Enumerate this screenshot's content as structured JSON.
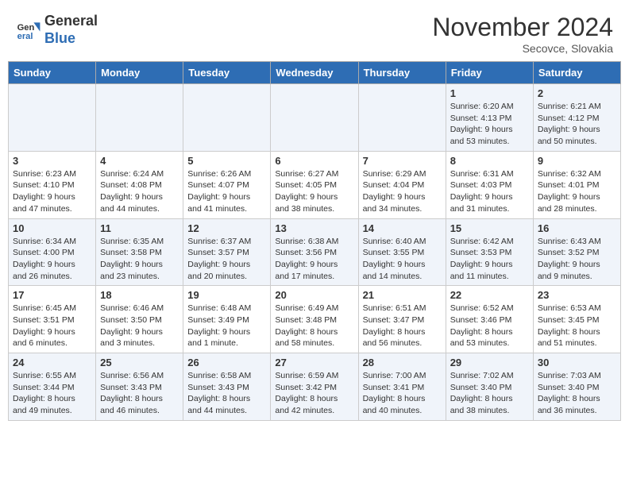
{
  "logo": {
    "line1": "General",
    "line2": "Blue"
  },
  "title": "November 2024",
  "subtitle": "Secovce, Slovakia",
  "days_of_week": [
    "Sunday",
    "Monday",
    "Tuesday",
    "Wednesday",
    "Thursday",
    "Friday",
    "Saturday"
  ],
  "weeks": [
    [
      {
        "day": "",
        "info": ""
      },
      {
        "day": "",
        "info": ""
      },
      {
        "day": "",
        "info": ""
      },
      {
        "day": "",
        "info": ""
      },
      {
        "day": "",
        "info": ""
      },
      {
        "day": "1",
        "info": "Sunrise: 6:20 AM\nSunset: 4:13 PM\nDaylight: 9 hours and 53 minutes."
      },
      {
        "day": "2",
        "info": "Sunrise: 6:21 AM\nSunset: 4:12 PM\nDaylight: 9 hours and 50 minutes."
      }
    ],
    [
      {
        "day": "3",
        "info": "Sunrise: 6:23 AM\nSunset: 4:10 PM\nDaylight: 9 hours and 47 minutes."
      },
      {
        "day": "4",
        "info": "Sunrise: 6:24 AM\nSunset: 4:08 PM\nDaylight: 9 hours and 44 minutes."
      },
      {
        "day": "5",
        "info": "Sunrise: 6:26 AM\nSunset: 4:07 PM\nDaylight: 9 hours and 41 minutes."
      },
      {
        "day": "6",
        "info": "Sunrise: 6:27 AM\nSunset: 4:05 PM\nDaylight: 9 hours and 38 minutes."
      },
      {
        "day": "7",
        "info": "Sunrise: 6:29 AM\nSunset: 4:04 PM\nDaylight: 9 hours and 34 minutes."
      },
      {
        "day": "8",
        "info": "Sunrise: 6:31 AM\nSunset: 4:03 PM\nDaylight: 9 hours and 31 minutes."
      },
      {
        "day": "9",
        "info": "Sunrise: 6:32 AM\nSunset: 4:01 PM\nDaylight: 9 hours and 28 minutes."
      }
    ],
    [
      {
        "day": "10",
        "info": "Sunrise: 6:34 AM\nSunset: 4:00 PM\nDaylight: 9 hours and 26 minutes."
      },
      {
        "day": "11",
        "info": "Sunrise: 6:35 AM\nSunset: 3:58 PM\nDaylight: 9 hours and 23 minutes."
      },
      {
        "day": "12",
        "info": "Sunrise: 6:37 AM\nSunset: 3:57 PM\nDaylight: 9 hours and 20 minutes."
      },
      {
        "day": "13",
        "info": "Sunrise: 6:38 AM\nSunset: 3:56 PM\nDaylight: 9 hours and 17 minutes."
      },
      {
        "day": "14",
        "info": "Sunrise: 6:40 AM\nSunset: 3:55 PM\nDaylight: 9 hours and 14 minutes."
      },
      {
        "day": "15",
        "info": "Sunrise: 6:42 AM\nSunset: 3:53 PM\nDaylight: 9 hours and 11 minutes."
      },
      {
        "day": "16",
        "info": "Sunrise: 6:43 AM\nSunset: 3:52 PM\nDaylight: 9 hours and 9 minutes."
      }
    ],
    [
      {
        "day": "17",
        "info": "Sunrise: 6:45 AM\nSunset: 3:51 PM\nDaylight: 9 hours and 6 minutes."
      },
      {
        "day": "18",
        "info": "Sunrise: 6:46 AM\nSunset: 3:50 PM\nDaylight: 9 hours and 3 minutes."
      },
      {
        "day": "19",
        "info": "Sunrise: 6:48 AM\nSunset: 3:49 PM\nDaylight: 9 hours and 1 minute."
      },
      {
        "day": "20",
        "info": "Sunrise: 6:49 AM\nSunset: 3:48 PM\nDaylight: 8 hours and 58 minutes."
      },
      {
        "day": "21",
        "info": "Sunrise: 6:51 AM\nSunset: 3:47 PM\nDaylight: 8 hours and 56 minutes."
      },
      {
        "day": "22",
        "info": "Sunrise: 6:52 AM\nSunset: 3:46 PM\nDaylight: 8 hours and 53 minutes."
      },
      {
        "day": "23",
        "info": "Sunrise: 6:53 AM\nSunset: 3:45 PM\nDaylight: 8 hours and 51 minutes."
      }
    ],
    [
      {
        "day": "24",
        "info": "Sunrise: 6:55 AM\nSunset: 3:44 PM\nDaylight: 8 hours and 49 minutes."
      },
      {
        "day": "25",
        "info": "Sunrise: 6:56 AM\nSunset: 3:43 PM\nDaylight: 8 hours and 46 minutes."
      },
      {
        "day": "26",
        "info": "Sunrise: 6:58 AM\nSunset: 3:43 PM\nDaylight: 8 hours and 44 minutes."
      },
      {
        "day": "27",
        "info": "Sunrise: 6:59 AM\nSunset: 3:42 PM\nDaylight: 8 hours and 42 minutes."
      },
      {
        "day": "28",
        "info": "Sunrise: 7:00 AM\nSunset: 3:41 PM\nDaylight: 8 hours and 40 minutes."
      },
      {
        "day": "29",
        "info": "Sunrise: 7:02 AM\nSunset: 3:40 PM\nDaylight: 8 hours and 38 minutes."
      },
      {
        "day": "30",
        "info": "Sunrise: 7:03 AM\nSunset: 3:40 PM\nDaylight: 8 hours and 36 minutes."
      }
    ]
  ]
}
